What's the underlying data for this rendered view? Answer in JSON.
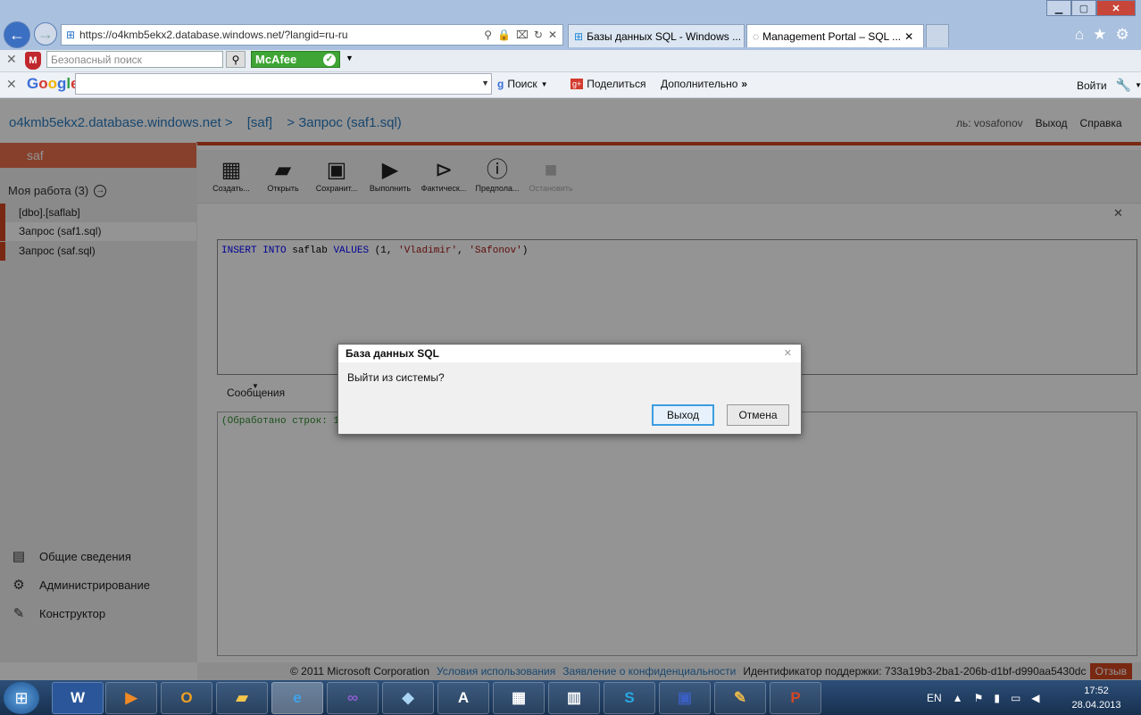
{
  "browser": {
    "url": "https://o4kmb5ekx2.database.windows.net/?langid=ru-ru",
    "tabs": [
      {
        "label": "Базы данных SQL - Windows ..."
      },
      {
        "label": "Management Portal – SQL ..."
      }
    ],
    "safe_search_placeholder": "Безопасный поиск",
    "mcafee_label": "McAfee",
    "google_label": "Google",
    "google_tools": {
      "search": "Поиск",
      "share": "Поделиться",
      "more": "Дополнительно",
      "signin": "Войти"
    }
  },
  "header": {
    "breadcrumb": [
      "o4kmb5ekx2.database.windows.net >",
      "[saf]",
      "> Запрос (saf1.sql)"
    ],
    "user": "ль: vosafonov",
    "logout": "Выход",
    "help": "Справка"
  },
  "sidebar": {
    "db_name": "saf",
    "my_work": "Моя работа (3)",
    "items": [
      {
        "label": "[dbo].[saflab]"
      },
      {
        "label": "Запрос (saf1.sql)"
      },
      {
        "label": "Запрос (saf.sql)"
      }
    ],
    "nav": [
      {
        "label": "Общие сведения",
        "icon": "overview-icon"
      },
      {
        "label": "Администрирование",
        "icon": "admin-icon"
      },
      {
        "label": "Конструктор",
        "icon": "designer-icon"
      }
    ]
  },
  "ribbon": [
    {
      "label": "Создать...",
      "icon": "new-query-icon"
    },
    {
      "label": "Открыть",
      "icon": "folder-icon"
    },
    {
      "label": "Сохранит...",
      "icon": "save-icon"
    },
    {
      "label": "Выполнить",
      "icon": "play-icon"
    },
    {
      "label": "Фактическ...",
      "icon": "actual-plan-icon"
    },
    {
      "label": "Предпола...",
      "icon": "estimated-plan-icon"
    },
    {
      "label": "Остановить",
      "icon": "stop-icon"
    }
  ],
  "editor": {
    "kw1": "INSERT INTO",
    "table": "saflab",
    "kw2": "VALUES",
    "open": "(1,",
    "s1": "'Vladimir'",
    "comma": ",",
    "s2": "'Safonov'",
    "close": ")"
  },
  "results": {
    "tab": "Сообщения",
    "message": "(Обработано строк: 1)"
  },
  "footer": {
    "copyright": "© 2011 Microsoft Corporation",
    "terms": "Условия использования",
    "privacy": "Заявление о конфиденциальности",
    "support_id": "Идентификатор поддержки: 733a19b3-2ba1-206b-d1bf-d990aa5430dc",
    "feedback": "Отзыв"
  },
  "dialog": {
    "title": "База данных SQL",
    "message": "Выйти из системы?",
    "ok": "Выход",
    "cancel": "Отмена"
  },
  "taskbar": {
    "lang": "EN",
    "time": "17:52",
    "date": "28.04.2013"
  },
  "colors": {
    "accent": "#d0451f",
    "link": "#2a7bc0",
    "message_green": "#2e8b2e"
  }
}
